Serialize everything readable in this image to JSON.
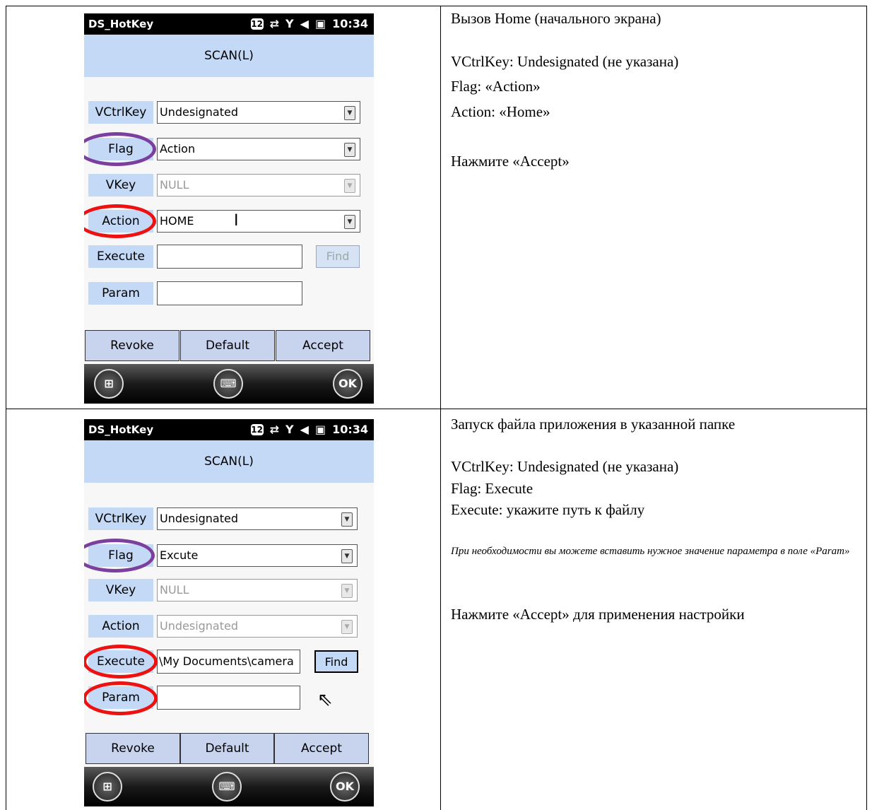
{
  "screens": [
    {
      "status": {
        "app": "DS_HotKey",
        "badge": "12",
        "time": "10:34"
      },
      "title": "SCAN(L)",
      "labels": {
        "vctrlkey": "VCtrlKey",
        "flag": "Flag",
        "vkey": "VKey",
        "action": "Action",
        "execute": "Execute",
        "param": "Param"
      },
      "values": {
        "vctrlkey": "Undesignated",
        "flag": "Action",
        "vkey": "NULL",
        "action": "HOME",
        "execute": "",
        "param": ""
      },
      "find": "Find",
      "buttons": {
        "revoke": "Revoke",
        "default": "Default",
        "accept": "Accept"
      },
      "ok": "OK"
    },
    {
      "status": {
        "app": "DS_HotKey",
        "badge": "12",
        "time": "10:34"
      },
      "title": "SCAN(L)",
      "labels": {
        "vctrlkey": "VCtrlKey",
        "flag": "Flag",
        "vkey": "VKey",
        "action": "Action",
        "execute": "Execute",
        "param": "Param"
      },
      "values": {
        "vctrlkey": "Undesignated",
        "flag": "Excute",
        "vkey": "NULL",
        "action": "Undesignated",
        "execute": "\\My Documents\\camera",
        "param": ""
      },
      "find": "Find",
      "buttons": {
        "revoke": "Revoke",
        "default": "Default",
        "accept": "Accept"
      },
      "ok": "OK"
    }
  ],
  "descriptions": [
    {
      "title": "Вызов Home (начального экрана)",
      "line1": "VCtrlKey: Undesignated (не указана)",
      "line2": "Flag: «Action»",
      "line3": "Action: «Home»",
      "line4": "Нажмите «Accept»"
    },
    {
      "title": "Запуск файла приложения в указанной папке",
      "line1": "VCtrlKey: Undesignated (не указана)",
      "line2": "Flag: Execute",
      "line3": "Execute: укажите путь к файлу",
      "note": "При необходимости вы можете вставить нужное значение параметра в поле «Param»",
      "line4": "Нажмите «Accept» для применения настройки"
    }
  ]
}
